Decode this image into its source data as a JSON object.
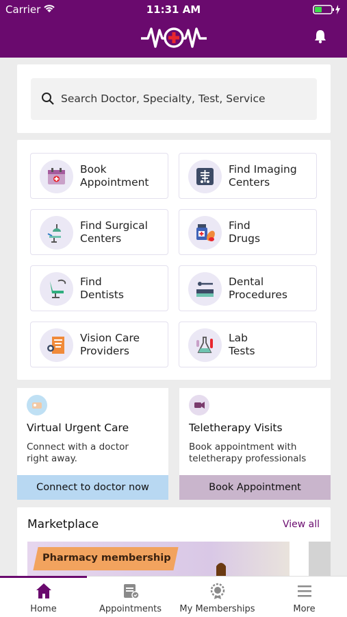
{
  "status_bar": {
    "carrier": "Carrier",
    "time": "11:31 AM"
  },
  "header": {
    "logo": "wow-logo",
    "bell": "bell-icon"
  },
  "search": {
    "placeholder": "Search Doctor, Specialty, Test, Service"
  },
  "services": [
    {
      "line1": "Book",
      "line2": "Appointment",
      "icon": "calendar-icon"
    },
    {
      "line1": "Find Imaging",
      "line2": "Centers",
      "icon": "xray-icon"
    },
    {
      "line1": "Find Surgical",
      "line2": "Centers",
      "icon": "surgical-light-icon"
    },
    {
      "line1": "Find",
      "line2": "Drugs",
      "icon": "pills-icon"
    },
    {
      "line1": "Find",
      "line2": "Dentists",
      "icon": "dental-chair-icon"
    },
    {
      "line1": "Dental",
      "line2": "Procedures",
      "icon": "dental-tools-icon"
    },
    {
      "line1": "Vision Care",
      "line2": "Providers",
      "icon": "eye-chart-icon"
    },
    {
      "line1": "Lab",
      "line2": "Tests",
      "icon": "lab-flask-icon"
    }
  ],
  "promos": [
    {
      "title": "Virtual Urgent Care",
      "desc_l1": "Connect with a doctor",
      "desc_l2": "right away.",
      "button": "Connect to doctor now",
      "button_color": "#b8d8f2",
      "icon_color": "#bfe0f4"
    },
    {
      "title": "Teletherapy Visits",
      "desc_l1": "Book appointment with",
      "desc_l2": "teletherapy professionals",
      "button": "Book Appointment",
      "button_color": "#c9b5cc",
      "icon_color": "#e6dcee"
    }
  ],
  "marketplace": {
    "title": "Marketplace",
    "view_all": "View all",
    "banner_label": "Pharmacy membership"
  },
  "tabs": [
    {
      "label": "Home",
      "icon": "home-icon",
      "active": true
    },
    {
      "label": "Appointments",
      "icon": "appointments-icon",
      "active": false
    },
    {
      "label": "My Memberships",
      "icon": "memberships-icon",
      "active": false
    },
    {
      "label": "More",
      "icon": "menu-icon",
      "active": false
    }
  ],
  "colors": {
    "brand": "#6a0a6e",
    "accent": "#e8262d"
  }
}
